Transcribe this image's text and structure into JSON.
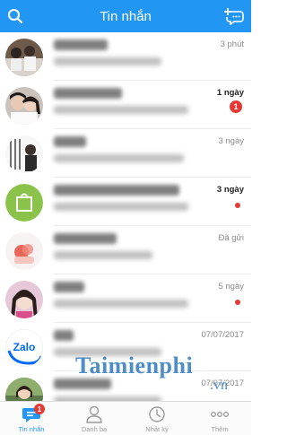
{
  "header": {
    "title": "Tin nhắn",
    "search_icon": "search-icon",
    "compose_icon": "compose-message-icon",
    "color": "#2296f3"
  },
  "conversations": [
    {
      "time": "3 phút",
      "unread": null,
      "dot": false,
      "bold_time": false
    },
    {
      "time": "1 ngày",
      "unread": "1",
      "dot": false,
      "bold_time": true
    },
    {
      "time": "3 ngày",
      "unread": null,
      "dot": false,
      "bold_time": false
    },
    {
      "time": "3 ngày",
      "unread": null,
      "dot": true,
      "bold_time": true
    },
    {
      "time": "Đã gửi",
      "unread": null,
      "dot": false,
      "bold_time": false
    },
    {
      "time": "5 ngày",
      "unread": null,
      "dot": true,
      "bold_time": false
    },
    {
      "time": "07/07/2017",
      "unread": null,
      "dot": false,
      "bold_time": false
    },
    {
      "time": "07/07/2017",
      "unread": null,
      "dot": false,
      "bold_time": false
    }
  ],
  "watermark": {
    "main": "Taimienphi",
    "sub": ".vn"
  },
  "avatar_logo_text": "Zalo",
  "tabbar": {
    "tabs": [
      {
        "label": "Tin nhắn",
        "icon": "chat-bubble-icon",
        "badge": "1"
      },
      {
        "label": "Danh bạ",
        "icon": "contacts-icon"
      },
      {
        "label": "Nhật ký",
        "icon": "clock-icon"
      },
      {
        "label": "Thêm",
        "icon": "more-icon"
      }
    ]
  }
}
